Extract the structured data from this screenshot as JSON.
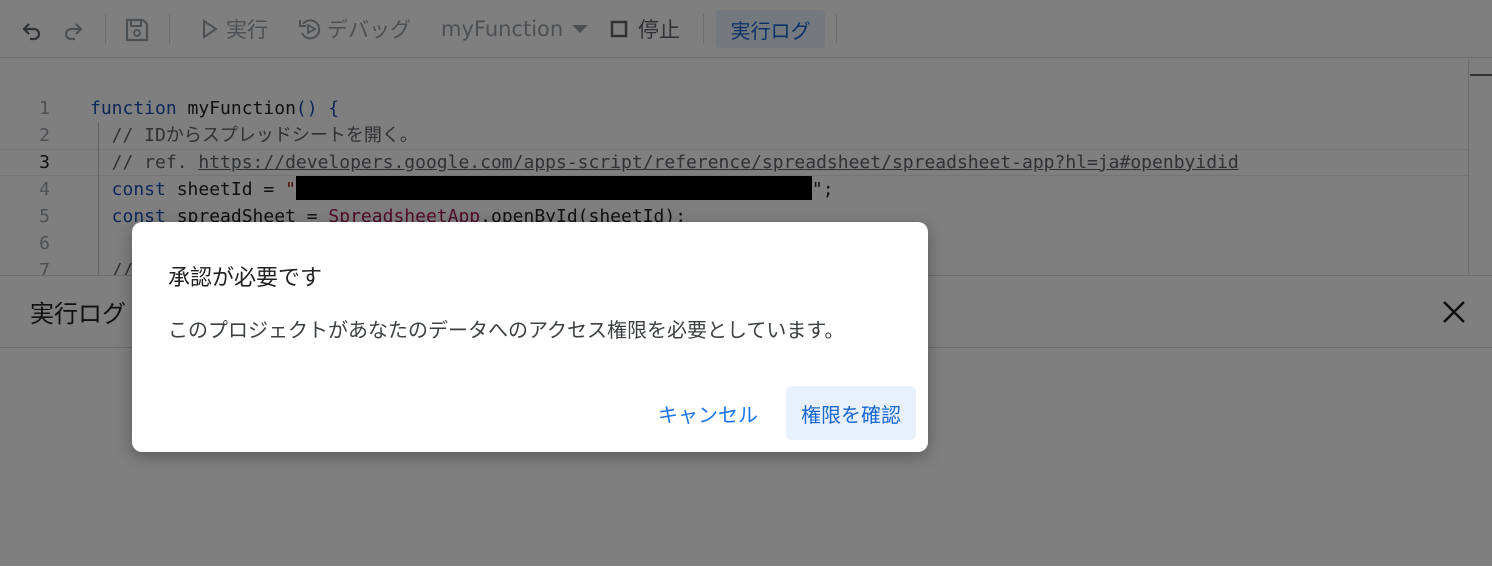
{
  "toolbar": {
    "run_label": "実行",
    "debug_label": "デバッグ",
    "function_select": "myFunction",
    "stop_label": "停止",
    "log_label": "実行ログ",
    "icons": [
      "undo-icon",
      "redo-icon",
      "save-icon",
      "play-icon",
      "debug-icon",
      "dropdown-caret-icon",
      "stop-icon"
    ]
  },
  "editor": {
    "lines": [
      {
        "no": "1",
        "parts": [
          {
            "t": "function",
            "c": "kw"
          },
          {
            "t": " myFunction",
            "c": ""
          },
          {
            "t": "() {",
            "c": "kw"
          }
        ]
      },
      {
        "no": "2",
        "parts": [
          {
            "t": "  // IDからスプレッドシートを開く。",
            "c": "cm"
          }
        ]
      },
      {
        "no": "3",
        "parts": [
          {
            "t": "  // ref. ",
            "c": "cm"
          },
          {
            "t": "https://developers.google.com/apps-script/reference/spreadsheet/spreadsheet-app?hl=ja#openbyidid",
            "c": "url"
          }
        ]
      },
      {
        "no": "4",
        "parts": [
          {
            "t": "  const",
            "c": "kw"
          },
          {
            "t": " sheetId = ",
            "c": ""
          },
          {
            "t": "\"",
            "c": "str"
          }
        ]
      },
      {
        "no": "5",
        "parts": [
          {
            "t": "  const",
            "c": "kw"
          },
          {
            "t": " spreadSheet = ",
            "c": ""
          },
          {
            "t": "SpreadsheetApp",
            "c": "cls"
          },
          {
            "t": ".openById(sheetId);",
            "c": ""
          }
        ]
      },
      {
        "no": "6",
        "parts": []
      },
      {
        "no": "7",
        "parts": [
          {
            "t": "  //",
            "c": "cm"
          }
        ]
      }
    ],
    "line4_tail": "\";"
  },
  "log_panel": {
    "title": "実行ログ"
  },
  "dialog": {
    "title": "承認が必要です",
    "body": "このプロジェクトがあなたのデータへのアクセス権限を必要としています。",
    "cancel_label": "キャンセル",
    "confirm_label": "権限を確認"
  }
}
